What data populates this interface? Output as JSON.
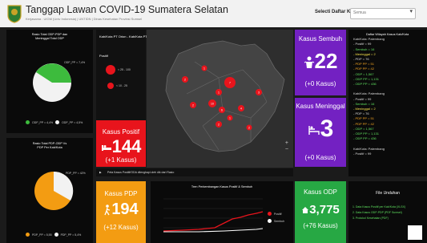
{
  "header": {
    "title": "Tanggap Lawan COVID-19 Sumatera Selatan",
    "subtitle": "Kerjasama : UIGM (Univ Indonesia) | UNTIDN | Dinas Kesehatan Provinsi Sumsel",
    "select_label": "Selecti Daftar Kab/Kota",
    "select_value": "Semua"
  },
  "left_top": {
    "title_line1": "Rasio Total ODP-PDP dan",
    "title_line2": "Meninggal Total ODP",
    "label_a": "ODP_PP = 7,4%",
    "legend": [
      "ODP_PP = 4,4%",
      "ODP_PP = 4,5%"
    ],
    "colors": [
      "#3dbb3d",
      "#f2f2f2"
    ]
  },
  "left_bottom": {
    "title_line1": "Rasio Total PDP-ODP Vs",
    "title_line2": "PDP Per Kab/Kota",
    "label_a": "PDP_PP = 42%",
    "legend": [
      "PDP_PP = 5,55",
      "PDP_PP = 5,4%"
    ],
    "colors": [
      "#f39c12",
      "#f2f2f2"
    ]
  },
  "map": {
    "legend_title": "Kab/Kota PT Orion - Kab/Kota PT",
    "legend_sub": "Positif",
    "legend_items": [
      "< 25 - 100",
      "< 10 - 25"
    ],
    "caption": "Peta Kasus Positif/ODA dilengkapi oleh dik dari Rasio",
    "markers": [
      "2",
      "1",
      "7",
      "1",
      "2",
      "10",
      "6",
      "4",
      "1",
      "2",
      "3",
      "2"
    ]
  },
  "cards": {
    "positif": {
      "title": "Kasus Positif",
      "value": "144",
      "sub": "(+1 Kasus)",
      "color": "#e8141c"
    },
    "sembuh": {
      "title": "Kasus Sembuh",
      "value": "22",
      "sub": "(+0 Kasus)",
      "color": "#7321c2"
    },
    "meninggal": {
      "title": "Kasus Meninggal",
      "value": "3",
      "sub": "(+0 Kasus)",
      "color": "#7321c2"
    },
    "pdp": {
      "title": "Kasus PDP",
      "value": "194",
      "sub": "(+12 Kasus)",
      "color": "#f39c12"
    },
    "odp": {
      "title": "Kasus ODP",
      "value": "3,775",
      "sub": "(+76 Kasus)",
      "color": "#27a844"
    }
  },
  "trend": {
    "title": "Tren Perkembangan Kasus Positif & Sembuh",
    "legend": [
      "Positif",
      "Sembuh"
    ],
    "colors": [
      "#e8141c",
      "#ffffff"
    ]
  },
  "right_list": {
    "heading": "Daftar Wilayah Kasus Kab/Kota",
    "lines": [
      {
        "t": "Kab/Kota: Palembang",
        "c": ""
      },
      {
        "t": "- Positif = 99",
        "c": ""
      },
      {
        "t": "- Sembuh = 16",
        "c": "green"
      },
      {
        "t": "- Meninggal = 2",
        "c": "yellow"
      },
      {
        "t": "- PDP = 76",
        "c": ""
      },
      {
        "t": "- PDP PP = 51",
        "c": "orange"
      },
      {
        "t": "- PDP PP = 42",
        "c": "orange"
      },
      {
        "t": "- ODP = 1,567",
        "c": "green"
      },
      {
        "t": "- ODP PP = 1,131",
        "c": "green"
      },
      {
        "t": "- ODP PP = 436",
        "c": "green"
      },
      {
        "t": "",
        "c": ""
      },
      {
        "t": "Kab/Kota: Palembang",
        "c": ""
      },
      {
        "t": "- Positif = 99",
        "c": ""
      },
      {
        "t": "- Sembuh = 16",
        "c": "green"
      },
      {
        "t": "- Meninggal = 2",
        "c": "yellow"
      },
      {
        "t": "- PDP = 76",
        "c": ""
      },
      {
        "t": "- PDP PP = 51",
        "c": "orange"
      },
      {
        "t": "- PDP PP = 42",
        "c": "orange"
      },
      {
        "t": "- ODP = 1,567",
        "c": "green"
      },
      {
        "t": "- ODP PP = 1,131",
        "c": "green"
      },
      {
        "t": "- ODP PP = 436",
        "c": "green"
      },
      {
        "t": "",
        "c": ""
      },
      {
        "t": "Kab/Kota: Palembang",
        "c": ""
      },
      {
        "t": "- Positif = 99",
        "c": ""
      }
    ]
  },
  "file_panel": {
    "title": "File Unduhan",
    "items": [
      "1. Data Kasus Positif per Kab/Kota (XLSX)",
      "2. Data Kasus ODP-PDP (PDF Sumsel)",
      "3. Protokol Kesehatan (PDF)"
    ]
  }
}
